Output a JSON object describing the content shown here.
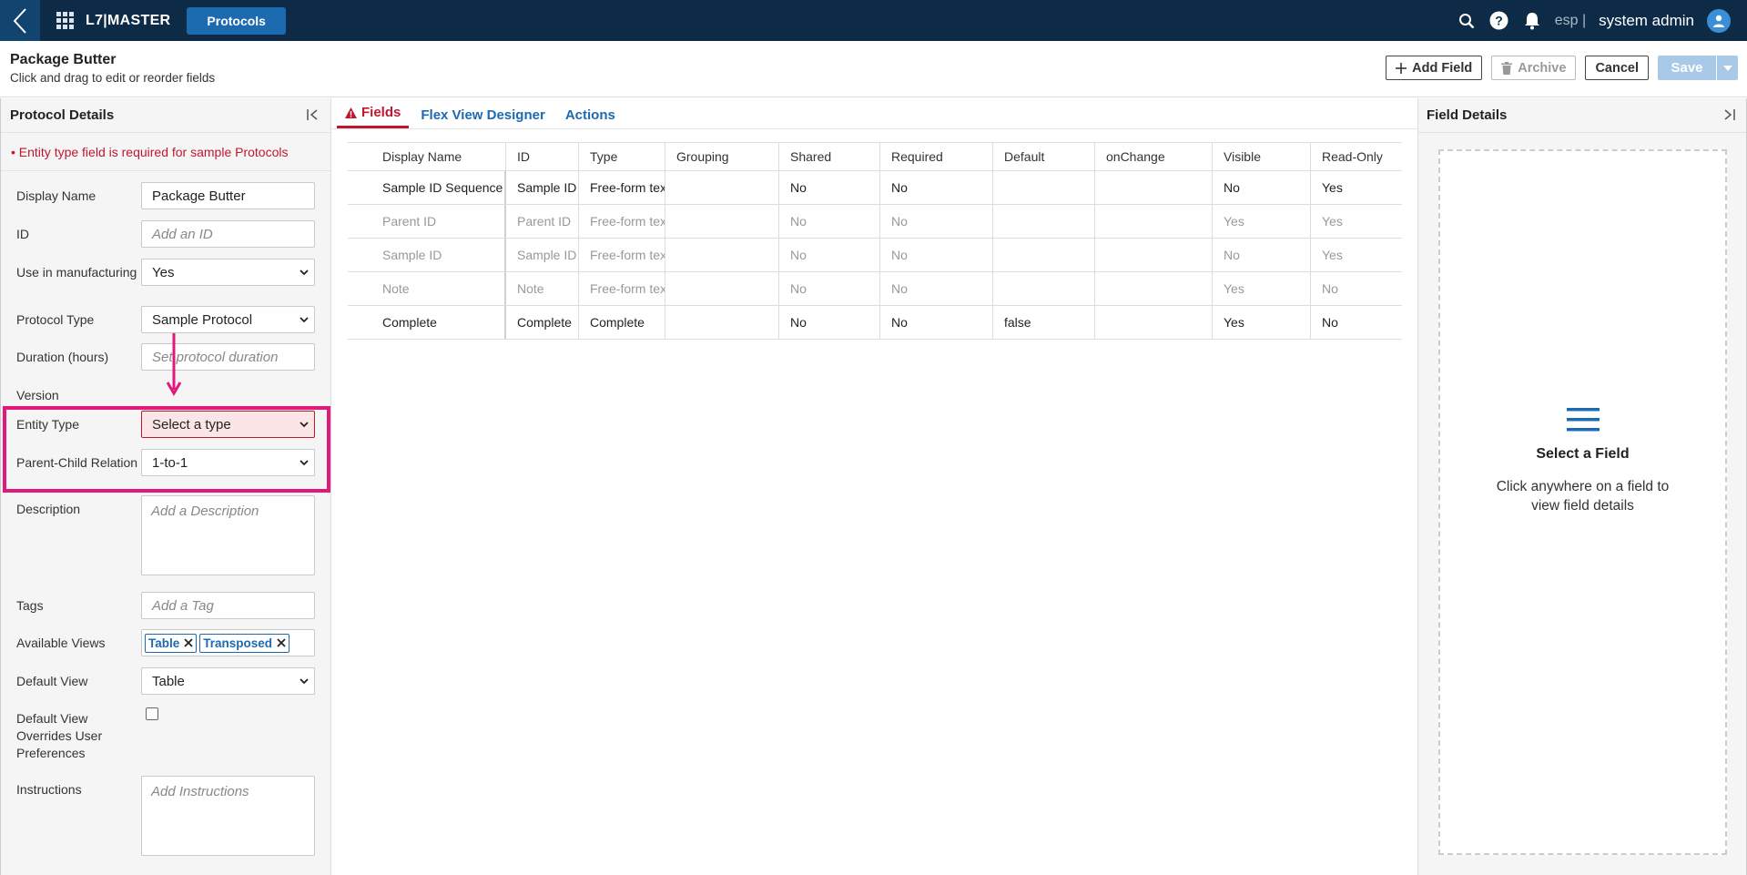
{
  "topbar": {
    "app_name": "L7|MASTER",
    "active_app_tab": "Protocols",
    "tenant": "esp |",
    "user": "system admin"
  },
  "header": {
    "title": "Package Butter",
    "subtitle": "Click and drag to edit or reorder fields",
    "add_field": "Add Field",
    "archive": "Archive",
    "cancel": "Cancel",
    "save": "Save"
  },
  "left": {
    "title": "Protocol Details",
    "error": "• Entity type field is required for sample Protocols",
    "fields": {
      "display_name": {
        "label": "Display Name",
        "value": "Package Butter"
      },
      "id": {
        "label": "ID",
        "placeholder": "Add an ID"
      },
      "use_in_manufacturing": {
        "label": "Use in manufacturing",
        "value": "Yes"
      },
      "protocol_type": {
        "label": "Protocol Type",
        "value": "Sample Protocol"
      },
      "duration": {
        "label": "Duration (hours)",
        "placeholder": "Set protocol duration"
      },
      "version": {
        "label": "Version"
      },
      "entity_type": {
        "label": "Entity Type",
        "value": "Select a type"
      },
      "parent_child": {
        "label": "Parent-Child Relation",
        "value": "1-to-1"
      },
      "description": {
        "label": "Description",
        "placeholder": "Add a Description"
      },
      "tags": {
        "label": "Tags",
        "placeholder": "Add a Tag"
      },
      "available_views": {
        "label": "Available Views",
        "chips": [
          "Table",
          "Transposed"
        ]
      },
      "default_view": {
        "label": "Default View",
        "value": "Table"
      },
      "default_view_overrides": {
        "label": "Default View Overrides User Preferences",
        "checked": false
      },
      "instructions": {
        "label": "Instructions",
        "placeholder": "Add Instructions"
      }
    }
  },
  "main": {
    "tabs": [
      "Fields",
      "Flex View Designer",
      "Actions"
    ],
    "active_tab": "Fields",
    "columns": [
      "Display Name",
      "ID",
      "Type",
      "Grouping",
      "Shared",
      "Required",
      "Default",
      "onChange",
      "Visible",
      "Read-Only"
    ],
    "rows": [
      {
        "dim": false,
        "cells": [
          "Sample ID Sequence",
          "Sample ID",
          "Free-form tex",
          "",
          "No",
          "No",
          "",
          "",
          "No",
          "Yes"
        ]
      },
      {
        "dim": true,
        "cells": [
          "Parent ID",
          "Parent ID",
          "Free-form tex",
          "",
          "No",
          "No",
          "",
          "",
          "Yes",
          "Yes"
        ]
      },
      {
        "dim": true,
        "cells": [
          "Sample ID",
          "Sample ID",
          "Free-form tex",
          "",
          "No",
          "No",
          "",
          "",
          "No",
          "Yes"
        ]
      },
      {
        "dim": true,
        "cells": [
          "Note",
          "Note",
          "Free-form tex",
          "",
          "No",
          "No",
          "",
          "",
          "Yes",
          "No"
        ]
      },
      {
        "dim": false,
        "cells": [
          "Complete",
          "Complete",
          "Complete",
          "",
          "No",
          "No",
          "false",
          "",
          "Yes",
          "No"
        ]
      }
    ]
  },
  "right": {
    "title": "Field Details",
    "empty_title": "Select a Field",
    "empty_desc": "Click anywhere on a field to view field details"
  },
  "colors": {
    "topbar": "#0d2b46",
    "accent": "#1c6ab0",
    "error": "#c0172f",
    "annotation": "#e0197a"
  }
}
